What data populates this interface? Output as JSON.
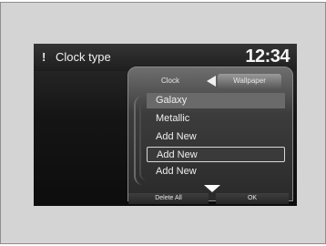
{
  "header": {
    "title": "Clock type",
    "time": "12:34"
  },
  "tabs": [
    {
      "label": "Clock"
    },
    {
      "label": "Wallpaper"
    }
  ],
  "list": {
    "items": [
      {
        "label": "Galaxy"
      },
      {
        "label": "Metallic"
      },
      {
        "label": "Add New"
      },
      {
        "label": "Add New"
      },
      {
        "label": "Add New"
      }
    ]
  },
  "footer": {
    "delete_all_label": "Delete All",
    "ok_label": "OK"
  },
  "icons": {
    "info": "info-icon",
    "back": "left-arrow-icon",
    "more": "down-arrow-icon"
  }
}
